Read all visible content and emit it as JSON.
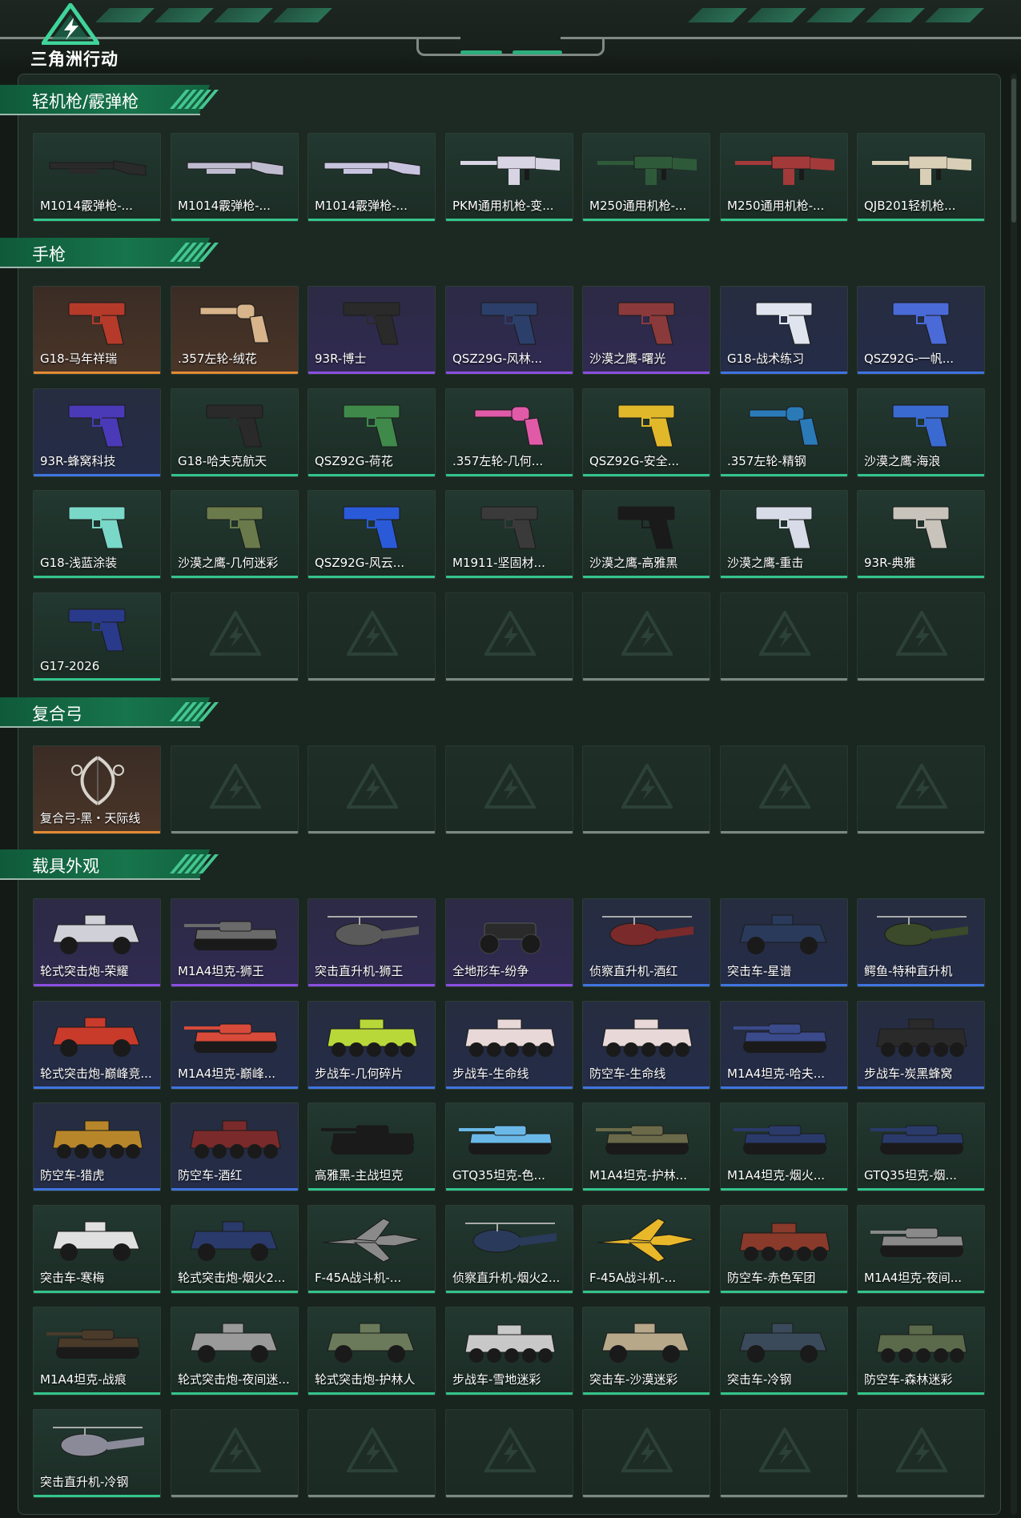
{
  "app": {
    "logo_text": "三角洲行动"
  },
  "colors": {
    "accent": "#34c48b",
    "rarity_green": "#34c48b",
    "rarity_gold": "#e38a32",
    "rarity_purple": "#8b4fe0",
    "rarity_blue": "#3f74df",
    "empty_slot": "#7c8884"
  },
  "sections": [
    {
      "title": "轻机枪/霰弹枪",
      "items": [
        {
          "name": "M1014霰弹枪-...",
          "rarity": "green",
          "icon": "shotgun-icon",
          "color": "#2a2a2a"
        },
        {
          "name": "M1014霰弹枪-...",
          "rarity": "green",
          "icon": "shotgun-icon",
          "color": "#c0bcd0"
        },
        {
          "name": "M1014霰弹枪-...",
          "rarity": "green",
          "icon": "shotgun-icon",
          "color": "#c8c4e0"
        },
        {
          "name": "PKM通用机枪-变...",
          "rarity": "green",
          "icon": "machine-gun-icon",
          "color": "#d8d4e4"
        },
        {
          "name": "M250通用机枪-...",
          "rarity": "green",
          "icon": "machine-gun-icon",
          "color": "#2f5a3a"
        },
        {
          "name": "M250通用机枪-...",
          "rarity": "green",
          "icon": "machine-gun-icon",
          "color": "#a33a3a"
        },
        {
          "name": "QJB201轻机枪...",
          "rarity": "green",
          "icon": "machine-gun-icon",
          "color": "#d8cfb6"
        }
      ]
    },
    {
      "title": "手枪",
      "items": [
        {
          "name": "G18-马年祥瑞",
          "rarity": "gold",
          "icon": "pistol-icon",
          "color": "#b53a2a"
        },
        {
          "name": ".357左轮-绒花",
          "rarity": "gold",
          "icon": "revolver-icon",
          "color": "#d8b48a"
        },
        {
          "name": "93R-博士",
          "rarity": "purple",
          "icon": "pistol-icon",
          "color": "#2a2a2a"
        },
        {
          "name": "QSZ29G-风林...",
          "rarity": "purple",
          "icon": "pistol-icon",
          "color": "#2c3f6a"
        },
        {
          "name": "沙漠之鹰-曙光",
          "rarity": "purple",
          "icon": "pistol-icon",
          "color": "#8a3a3a"
        },
        {
          "name": "G18-战术练习",
          "rarity": "blue",
          "icon": "pistol-icon",
          "color": "#e0e4ee"
        },
        {
          "name": "QSZ92G-一帆...",
          "rarity": "blue",
          "icon": "pistol-icon",
          "color": "#4a6ad8"
        },
        {
          "name": "93R-蜂窝科技",
          "rarity": "blue",
          "icon": "pistol-icon",
          "color": "#4a3ab8"
        },
        {
          "name": "G18-哈夫克航天",
          "rarity": "green",
          "icon": "pistol-icon",
          "color": "#2a2a2a"
        },
        {
          "name": "QSZ92G-荷花",
          "rarity": "green",
          "icon": "pistol-icon",
          "color": "#3f8a4a"
        },
        {
          "name": ".357左轮-几何...",
          "rarity": "green",
          "icon": "revolver-icon",
          "color": "#e05aa8"
        },
        {
          "name": "QSZ92G-安全...",
          "rarity": "green",
          "icon": "pistol-icon",
          "color": "#e0b82a"
        },
        {
          "name": ".357左轮-精钢",
          "rarity": "green",
          "icon": "revolver-icon",
          "color": "#2a7ab8"
        },
        {
          "name": "沙漠之鹰-海浪",
          "rarity": "green",
          "icon": "pistol-icon",
          "color": "#3a6ad0"
        },
        {
          "name": "G18-浅蓝涂装",
          "rarity": "green",
          "icon": "pistol-icon",
          "color": "#7ad8c8"
        },
        {
          "name": "沙漠之鹰-几何迷彩",
          "rarity": "green",
          "icon": "pistol-icon",
          "color": "#6a7a4a"
        },
        {
          "name": "QSZ92G-风云...",
          "rarity": "green",
          "icon": "pistol-icon",
          "color": "#2a5ad8"
        },
        {
          "name": "M1911-坚固材...",
          "rarity": "green",
          "icon": "pistol-icon",
          "color": "#3a3a3a"
        },
        {
          "name": "沙漠之鹰-高雅黑",
          "rarity": "green",
          "icon": "pistol-icon",
          "color": "#1a1a1a"
        },
        {
          "name": "沙漠之鹰-重击",
          "rarity": "green",
          "icon": "pistol-icon",
          "color": "#d8dce8"
        },
        {
          "name": "93R-典雅",
          "rarity": "green",
          "icon": "pistol-icon",
          "color": "#c8c4bc"
        },
        {
          "name": "G17-2026",
          "rarity": "green",
          "icon": "pistol-icon",
          "color": "#2a3a8a"
        }
      ]
    },
    {
      "title": "复合弓",
      "items": [
        {
          "name": "复合弓-黑・天际线",
          "rarity": "gold",
          "icon": "bow-icon",
          "color": "#d8d4cc"
        }
      ]
    },
    {
      "title": "载具外观",
      "items": [
        {
          "name": "轮式突击炮-荣耀",
          "rarity": "purple",
          "icon": "armored-car-icon",
          "color": "#d0d0d8"
        },
        {
          "name": "M1A4坦克-狮王",
          "rarity": "purple",
          "icon": "tank-icon",
          "color": "#6a6a6a"
        },
        {
          "name": "突击直升机-狮王",
          "rarity": "purple",
          "icon": "helicopter-icon",
          "color": "#5a5a5a"
        },
        {
          "name": "全地形车-纷争",
          "rarity": "purple",
          "icon": "atv-icon",
          "color": "#2a2a2a"
        },
        {
          "name": "侦察直升机-酒红",
          "rarity": "blue",
          "icon": "helicopter-icon",
          "color": "#7a2a2a"
        },
        {
          "name": "突击车-星谱",
          "rarity": "blue",
          "icon": "armored-car-icon",
          "color": "#2a3a5a"
        },
        {
          "name": "鳄鱼-特种直升机",
          "rarity": "blue",
          "icon": "helicopter-icon",
          "color": "#3a4a2a"
        },
        {
          "name": "轮式突击炮-巅峰竞...",
          "rarity": "blue",
          "icon": "armored-car-icon",
          "color": "#c83a2a"
        },
        {
          "name": "M1A4坦克-巅峰...",
          "rarity": "blue",
          "icon": "tank-icon",
          "color": "#d84a3a"
        },
        {
          "name": "步战车-几何碎片",
          "rarity": "blue",
          "icon": "ifv-icon",
          "color": "#b8d83a"
        },
        {
          "name": "步战车-生命线",
          "rarity": "blue",
          "icon": "ifv-icon",
          "color": "#e8d8d8"
        },
        {
          "name": "防空车-生命线",
          "rarity": "blue",
          "icon": "ifv-icon",
          "color": "#e8d8d8"
        },
        {
          "name": "M1A4坦克-哈夫...",
          "rarity": "blue",
          "icon": "tank-icon",
          "color": "#3a4a8a"
        },
        {
          "name": "步战车-炭黑蜂窝",
          "rarity": "blue",
          "icon": "ifv-icon",
          "color": "#2a2a2a"
        },
        {
          "name": "防空车-猎虎",
          "rarity": "blue",
          "icon": "ifv-icon",
          "color": "#b8862a"
        },
        {
          "name": "防空车-酒红",
          "rarity": "blue",
          "icon": "ifv-icon",
          "color": "#7a2a2a"
        },
        {
          "name": "高雅黑-主战坦克",
          "rarity": "green",
          "icon": "tank-icon",
          "color": "#1a1a1a"
        },
        {
          "name": "GTQ35坦克-色...",
          "rarity": "green",
          "icon": "tank-icon",
          "color": "#6ab8e8"
        },
        {
          "name": "M1A4坦克-护林...",
          "rarity": "green",
          "icon": "tank-icon",
          "color": "#6a6a4a"
        },
        {
          "name": "M1A4坦克-烟火...",
          "rarity": "green",
          "icon": "tank-icon",
          "color": "#2a3a6a"
        },
        {
          "name": "GTQ35坦克-烟...",
          "rarity": "green",
          "icon": "tank-icon",
          "color": "#2a3a6a"
        },
        {
          "name": "突击车-寒梅",
          "rarity": "green",
          "icon": "armored-car-icon",
          "color": "#e0e0e0"
        },
        {
          "name": "轮式突击炮-烟火2...",
          "rarity": "green",
          "icon": "armored-car-icon",
          "color": "#2a3a6a"
        },
        {
          "name": "F-45A战斗机-...",
          "rarity": "green",
          "icon": "jet-icon",
          "color": "#8a8a8a"
        },
        {
          "name": "侦察直升机-烟火2...",
          "rarity": "green",
          "icon": "helicopter-icon",
          "color": "#2a3a5a"
        },
        {
          "name": "F-45A战斗机-...",
          "rarity": "green",
          "icon": "jet-icon",
          "color": "#e8b82a"
        },
        {
          "name": "防空车-赤色军团",
          "rarity": "green",
          "icon": "ifv-icon",
          "color": "#8a3a2a"
        },
        {
          "name": "M1A4坦克-夜间...",
          "rarity": "green",
          "icon": "tank-icon",
          "color": "#8a8a8a"
        },
        {
          "name": "M1A4坦克-战痕",
          "rarity": "green",
          "icon": "tank-icon",
          "color": "#4a3a2a"
        },
        {
          "name": "轮式突击炮-夜间迷...",
          "rarity": "green",
          "icon": "armored-car-icon",
          "color": "#9a9a9a"
        },
        {
          "name": "轮式突击炮-护林人",
          "rarity": "green",
          "icon": "armored-car-icon",
          "color": "#6a7a5a"
        },
        {
          "name": "步战车-雪地迷彩",
          "rarity": "green",
          "icon": "ifv-icon",
          "color": "#c8c8c8"
        },
        {
          "name": "突击车-沙漠迷彩",
          "rarity": "green",
          "icon": "armored-car-icon",
          "color": "#b8a88a"
        },
        {
          "name": "突击车-冷钢",
          "rarity": "green",
          "icon": "armored-car-icon",
          "color": "#3a4a5a"
        },
        {
          "name": "防空车-森林迷彩",
          "rarity": "green",
          "icon": "ifv-icon",
          "color": "#5a6a4a"
        },
        {
          "name": "突击直升机-冷钢",
          "rarity": "green",
          "icon": "helicopter-icon",
          "color": "#8a8a98"
        }
      ]
    }
  ]
}
